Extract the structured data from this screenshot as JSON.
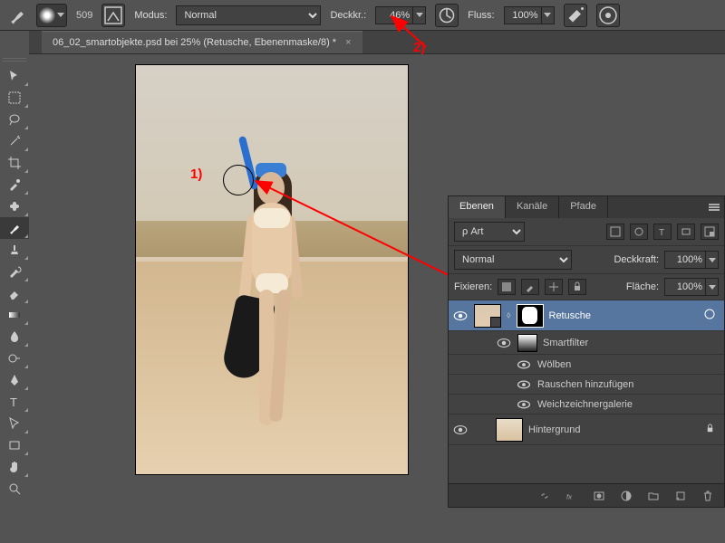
{
  "options_bar": {
    "brush_size": "509",
    "mode_label": "Modus:",
    "mode_value": "Normal",
    "opacity_label": "Deckkr.:",
    "opacity_value": "46%",
    "flow_label": "Fluss:",
    "flow_value": "100%"
  },
  "document": {
    "tab_title": "06_02_smartobjekte.psd bei 25% (Retusche, Ebenenmaske/8) *"
  },
  "annotations": {
    "mark1": "1)",
    "mark2": "2)"
  },
  "layers_panel": {
    "tabs": [
      "Ebenen",
      "Kanäle",
      "Pfade"
    ],
    "filter_kind": "Art",
    "blend_mode": "Normal",
    "opacity_label": "Deckkraft:",
    "opacity_value": "100%",
    "lock_label": "Fixieren:",
    "fill_label": "Fläche:",
    "fill_value": "100%",
    "layers": [
      {
        "name": "Retusche",
        "selected": true,
        "smart": true
      },
      {
        "name": "Smartfilter"
      },
      {
        "name": "Wölben"
      },
      {
        "name": "Rauschen hinzufügen"
      },
      {
        "name": "Weichzeichnergalerie"
      },
      {
        "name": "Hintergrund",
        "locked": true
      }
    ]
  }
}
